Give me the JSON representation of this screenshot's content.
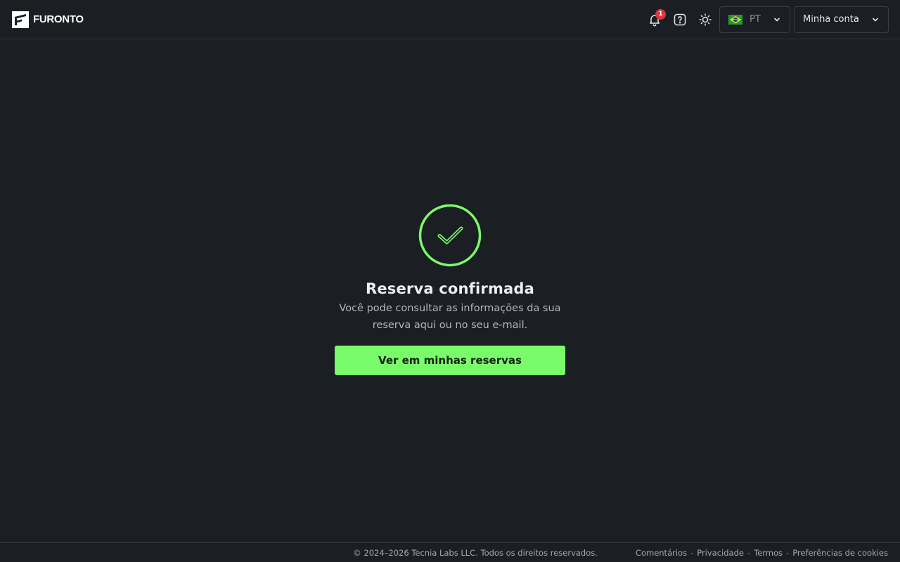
{
  "header": {
    "brand": "FURONTO",
    "notifications_count": "1",
    "language": {
      "code": "PT",
      "flag": "brazil-flag-icon"
    },
    "account_label": "Minha conta",
    "icons": [
      "bell-icon",
      "help-icon",
      "sun-icon",
      "chevron-down-icon"
    ]
  },
  "confirmation": {
    "icon": "check-circle-icon",
    "title": "Reserva confirmada",
    "subtitle": "Você pode consultar as informações da sua reserva aqui ou no seu e-mail.",
    "button_label": "Ver em minhas reservas"
  },
  "footer": {
    "copyright": "© 2024–2026 Tecnia Labs LLC. Todos os direitos reservados.",
    "links": [
      "Comentários",
      "Privacidade",
      "Termos",
      "Preferências de cookies"
    ],
    "separator": "-"
  },
  "colors": {
    "background": "#1b1e23",
    "accent": "#79fc6a",
    "badge": "#d9363e",
    "border": "#33373d"
  }
}
